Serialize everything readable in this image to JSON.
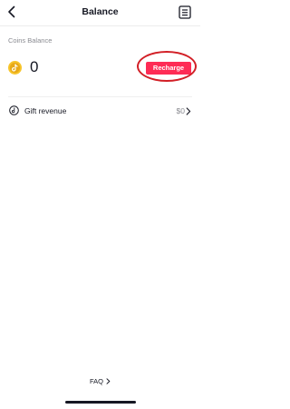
{
  "header": {
    "title": "Balance",
    "back_icon": "chevron-left-icon",
    "history_icon": "receipt-icon"
  },
  "balance": {
    "label": "Coins Balance",
    "coin_icon": "tiktok-coin-icon",
    "count": "0",
    "recharge_label": "Recharge"
  },
  "gift_revenue": {
    "label": "Gift revenue",
    "value": "$0",
    "icon": "gift-revenue-icon"
  },
  "footer": {
    "faq_label": "FAQ"
  },
  "colors": {
    "accent": "#fe2c55",
    "highlight_annotation": "#d21f26",
    "coin": "#f7c52b",
    "text": "#161823",
    "muted": "#8a8b91"
  }
}
